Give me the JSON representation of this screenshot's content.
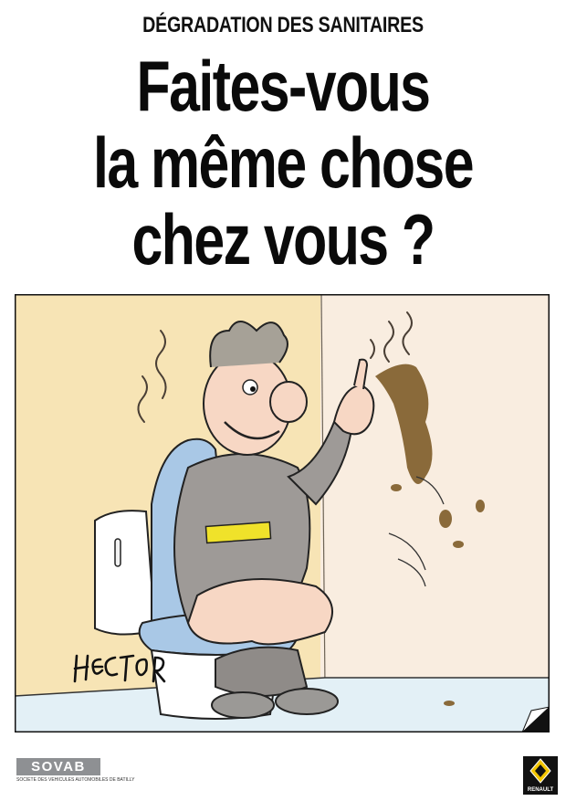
{
  "poster": {
    "kicker": "DÉGRADATION DES SANITAIRES",
    "headline": [
      "Faites-vous",
      "la même chose",
      "chez vous ?"
    ],
    "signature": "HECTOR"
  },
  "footer": {
    "sovab_logo": "SOVAB",
    "sovab_tagline": "SOCIETE DES VEHICULES AUTOMOBILES DE BATILLY",
    "renault_logo": "RENAULT"
  },
  "colors": {
    "wall_left": "#f7e4b5",
    "wall_right": "#f9ede0",
    "floor": "#e3f0f6",
    "toilet_lid": "#a9c8e6",
    "overalls": "#9e9a97",
    "belt": "#f0e22a",
    "stain": "#8a6a3a"
  }
}
